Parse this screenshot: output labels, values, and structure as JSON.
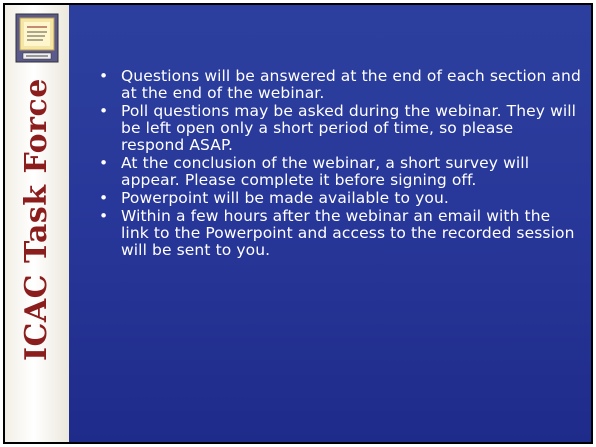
{
  "sidebar": {
    "title": "ICAC Task Force"
  },
  "content": {
    "bullets": [
      "Questions will be answered at the end of each section and at the end of the webinar.",
      "Poll questions may be asked during the webinar.  They will be left open only a short period of time, so please respond ASAP.",
      "At the conclusion of the webinar, a short survey will appear.  Please complete it before signing off.",
      "Powerpoint will be made available to you.",
      "Within a few hours after the webinar an email with the link to the Powerpoint and access to the recorded session will be sent to you."
    ]
  },
  "colors": {
    "background": "#28389a",
    "sidebar": "#f2efe6",
    "title": "#8b1d1d",
    "text": "#ffffff"
  }
}
